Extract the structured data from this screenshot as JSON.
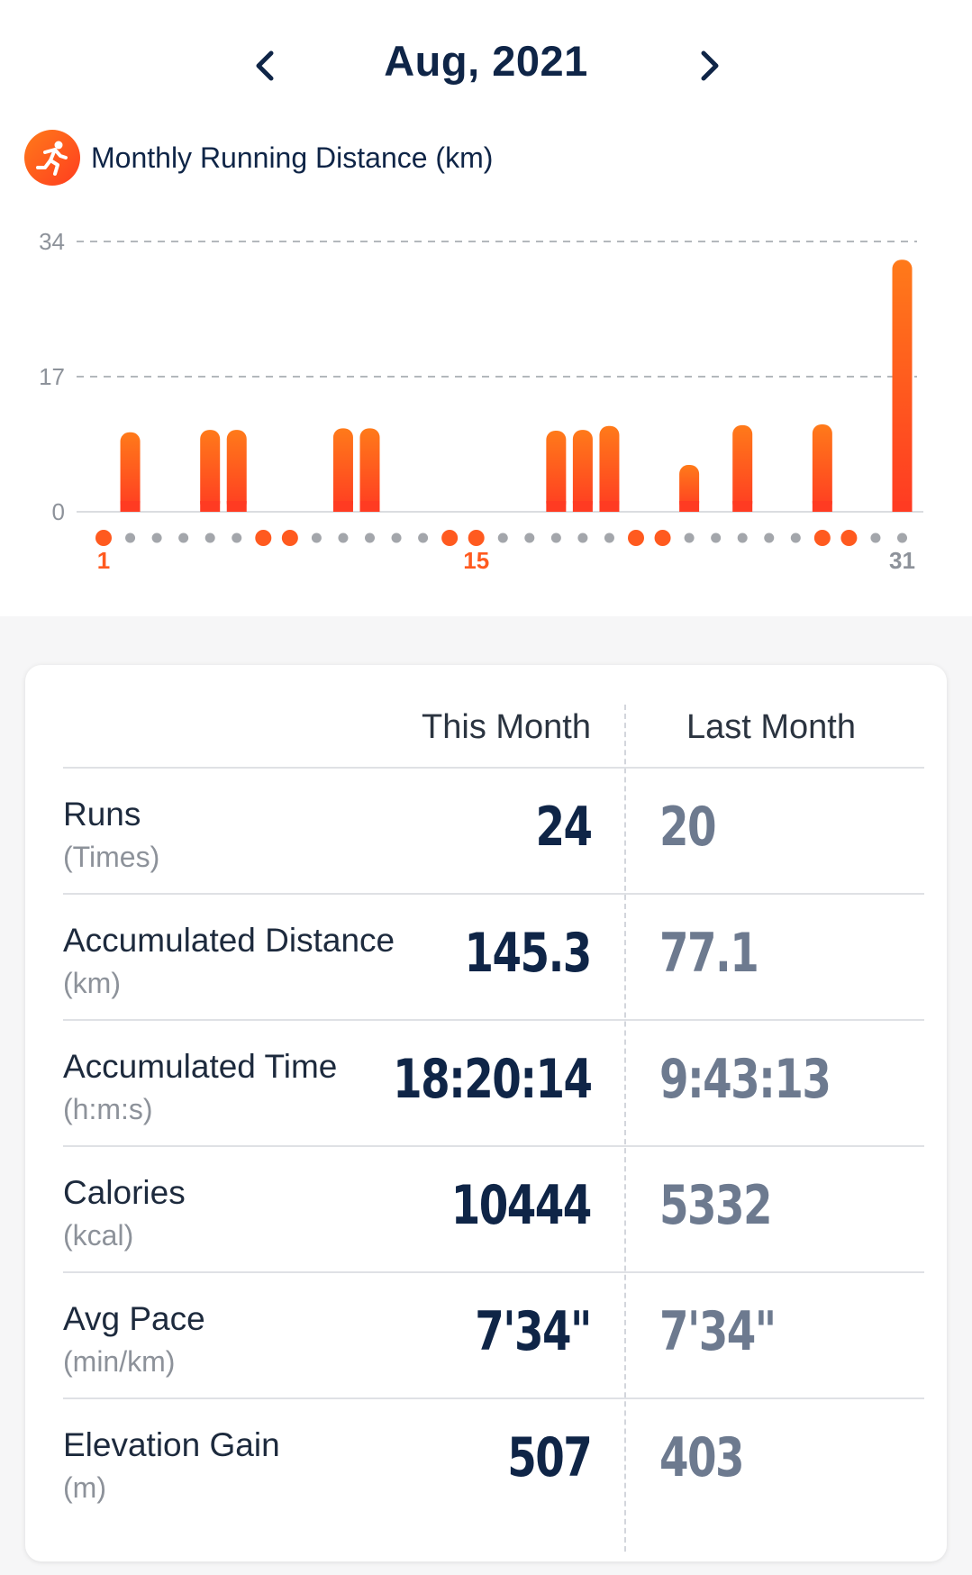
{
  "header": {
    "month_title": "Aug, 2021",
    "prev_icon": "chevron-left-icon",
    "next_icon": "chevron-right-icon"
  },
  "chart_section": {
    "icon": "running-icon",
    "title": "Monthly Running Distance (km)",
    "accent_color": "#ff5a1f"
  },
  "chart_data": {
    "type": "bar",
    "title": "Monthly Running Distance (km)",
    "x": [
      1,
      2,
      3,
      4,
      5,
      6,
      7,
      8,
      9,
      10,
      11,
      12,
      13,
      14,
      15,
      16,
      17,
      18,
      19,
      20,
      21,
      22,
      23,
      24,
      25,
      26,
      27,
      28,
      29,
      30,
      31
    ],
    "values": [
      0,
      10,
      0,
      0,
      10.3,
      10.3,
      0,
      0,
      0,
      10.5,
      10.5,
      0,
      0,
      0,
      0,
      0,
      0,
      10.2,
      10.3,
      10.8,
      0,
      0,
      5.9,
      0,
      10.9,
      0,
      0,
      11,
      0,
      0,
      31.7
    ],
    "run_days": [
      1,
      7,
      8,
      14,
      15,
      21,
      22,
      28,
      29
    ],
    "yticks": [
      0,
      17,
      34
    ],
    "ylim": [
      0,
      34
    ],
    "xtick_labels": [
      {
        "day": 1,
        "label": "1"
      },
      {
        "day": 15,
        "label": "15"
      },
      {
        "day": 31,
        "label": "31"
      }
    ],
    "grid": "horizontal dashed"
  },
  "stats": {
    "this_month_label": "This Month",
    "last_month_label": "Last Month",
    "rows": [
      {
        "label": "Runs",
        "unit": "(Times)",
        "this": "24",
        "last": "20"
      },
      {
        "label": "Accumulated Distance",
        "unit": "(km)",
        "this": "145.3",
        "last": "77.1"
      },
      {
        "label": "Accumulated Time",
        "unit": "(h:m:s)",
        "this": "18:20:14",
        "last": "9:43:13"
      },
      {
        "label": "Calories",
        "unit": "(kcal)",
        "this": "10444",
        "last": "5332"
      },
      {
        "label": "Avg Pace",
        "unit": "(min/km)",
        "this": "7'34\"",
        "last": "7'34\""
      },
      {
        "label": "Elevation Gain",
        "unit": "(m)",
        "this": "507",
        "last": "403"
      }
    ]
  }
}
